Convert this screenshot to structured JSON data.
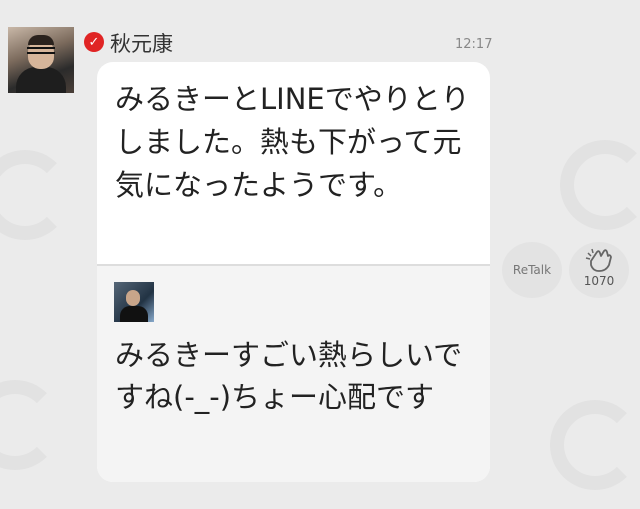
{
  "message": {
    "sender_name": "秋元康",
    "time": "12:17",
    "text": "みるきーとLINEでやりとりしました。熱も下がって元気になったようです。",
    "quote": {
      "text": "みるきーすごい熱らしいですね(-_-)ちょー心配です"
    }
  },
  "actions": {
    "retalk_label": "ReTalk",
    "like_count": "1070"
  },
  "icons": {
    "verified": "checkmark-badge-icon",
    "like": "clapping-hands-icon"
  },
  "colors": {
    "background": "#ebebeb",
    "bubble": "#ffffff",
    "quote_background": "#f4f4f4",
    "verified_badge": "#e02424"
  }
}
